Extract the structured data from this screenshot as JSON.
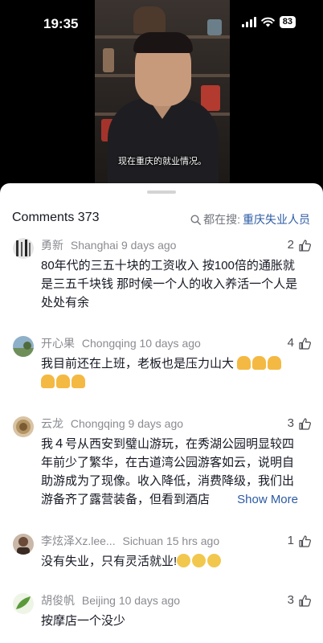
{
  "status_bar": {
    "time": "19:35",
    "battery": "83"
  },
  "video": {
    "caption": "现在重庆的就业情况。"
  },
  "comments_panel": {
    "title": "Comments 373",
    "search_label": "都在搜:",
    "search_keyword": "重庆失业人员"
  },
  "comments": [
    {
      "name": "勇新",
      "location": "Shanghai",
      "time": "9 days ago",
      "likes": "2",
      "text": "80年代的三五十块的工资收入  按100倍的通胀就是三五千块钱    那时候一个人的收入养活一个人是处处有余"
    },
    {
      "name": "开心果",
      "location": "Chongqing",
      "time": "10 days ago",
      "likes": "4",
      "text": "我目前还在上班，老板也是压力山大"
    },
    {
      "name": "云龙",
      "location": "Chongqing",
      "time": "9 days ago",
      "likes": "3",
      "text": "我４号从西安到璧山游玩，在秀湖公园明显较四年前少了繁华，在古道湾公园游客如云，说明自助游成为了现像。收入降低，消费降级，我们出游备齐了露营装备，但看到酒店",
      "show_more": "Show More"
    },
    {
      "name": "李炫泽Xz.lee...",
      "location": "Sichuan",
      "time": "15 hrs ago",
      "likes": "1",
      "text": "没有失业，只有灵活就业!"
    },
    {
      "name": "胡俊帆",
      "location": "Beijing",
      "time": "10 days ago",
      "likes": "3",
      "text": "按摩店一个没少"
    }
  ],
  "colors": {
    "link": "#2b5aa3",
    "meta": "#8a8b91",
    "text": "#161823"
  }
}
